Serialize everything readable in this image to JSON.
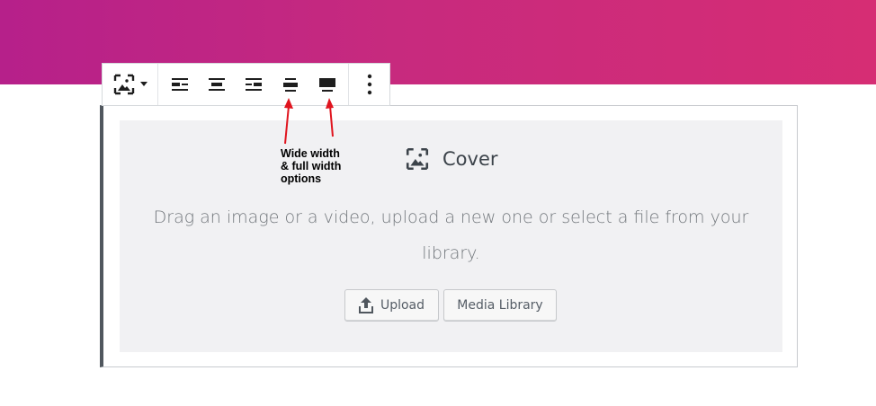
{
  "colors": {
    "hero_start": "#b6208a",
    "hero_end": "#d62d74",
    "annotation_arrow": "#e0141e",
    "placeholder_bg": "#f1f1f3",
    "block_border_left": "#50575e"
  },
  "toolbar": {
    "block_type_icon": "cover-image-icon",
    "block_type_caret": "caret-down-icon",
    "alignment_buttons": [
      {
        "name": "align-left",
        "icon": "align-left-icon"
      },
      {
        "name": "align-center",
        "icon": "align-center-icon"
      },
      {
        "name": "align-right",
        "icon": "align-right-icon"
      },
      {
        "name": "align-wide",
        "icon": "align-wide-icon"
      },
      {
        "name": "align-full",
        "icon": "align-full-icon"
      }
    ],
    "more_icon": "more-vertical-icon"
  },
  "placeholder": {
    "icon": "cover-image-icon",
    "title": "Cover",
    "instructions": "Drag an image or a video, upload a new one or select a file from your library.",
    "upload_icon": "upload-icon",
    "upload_label": "Upload",
    "media_library_label": "Media Library"
  },
  "annotation": {
    "text_line1": "Wide width",
    "text_line2": "& full width",
    "text_line3": "options"
  }
}
